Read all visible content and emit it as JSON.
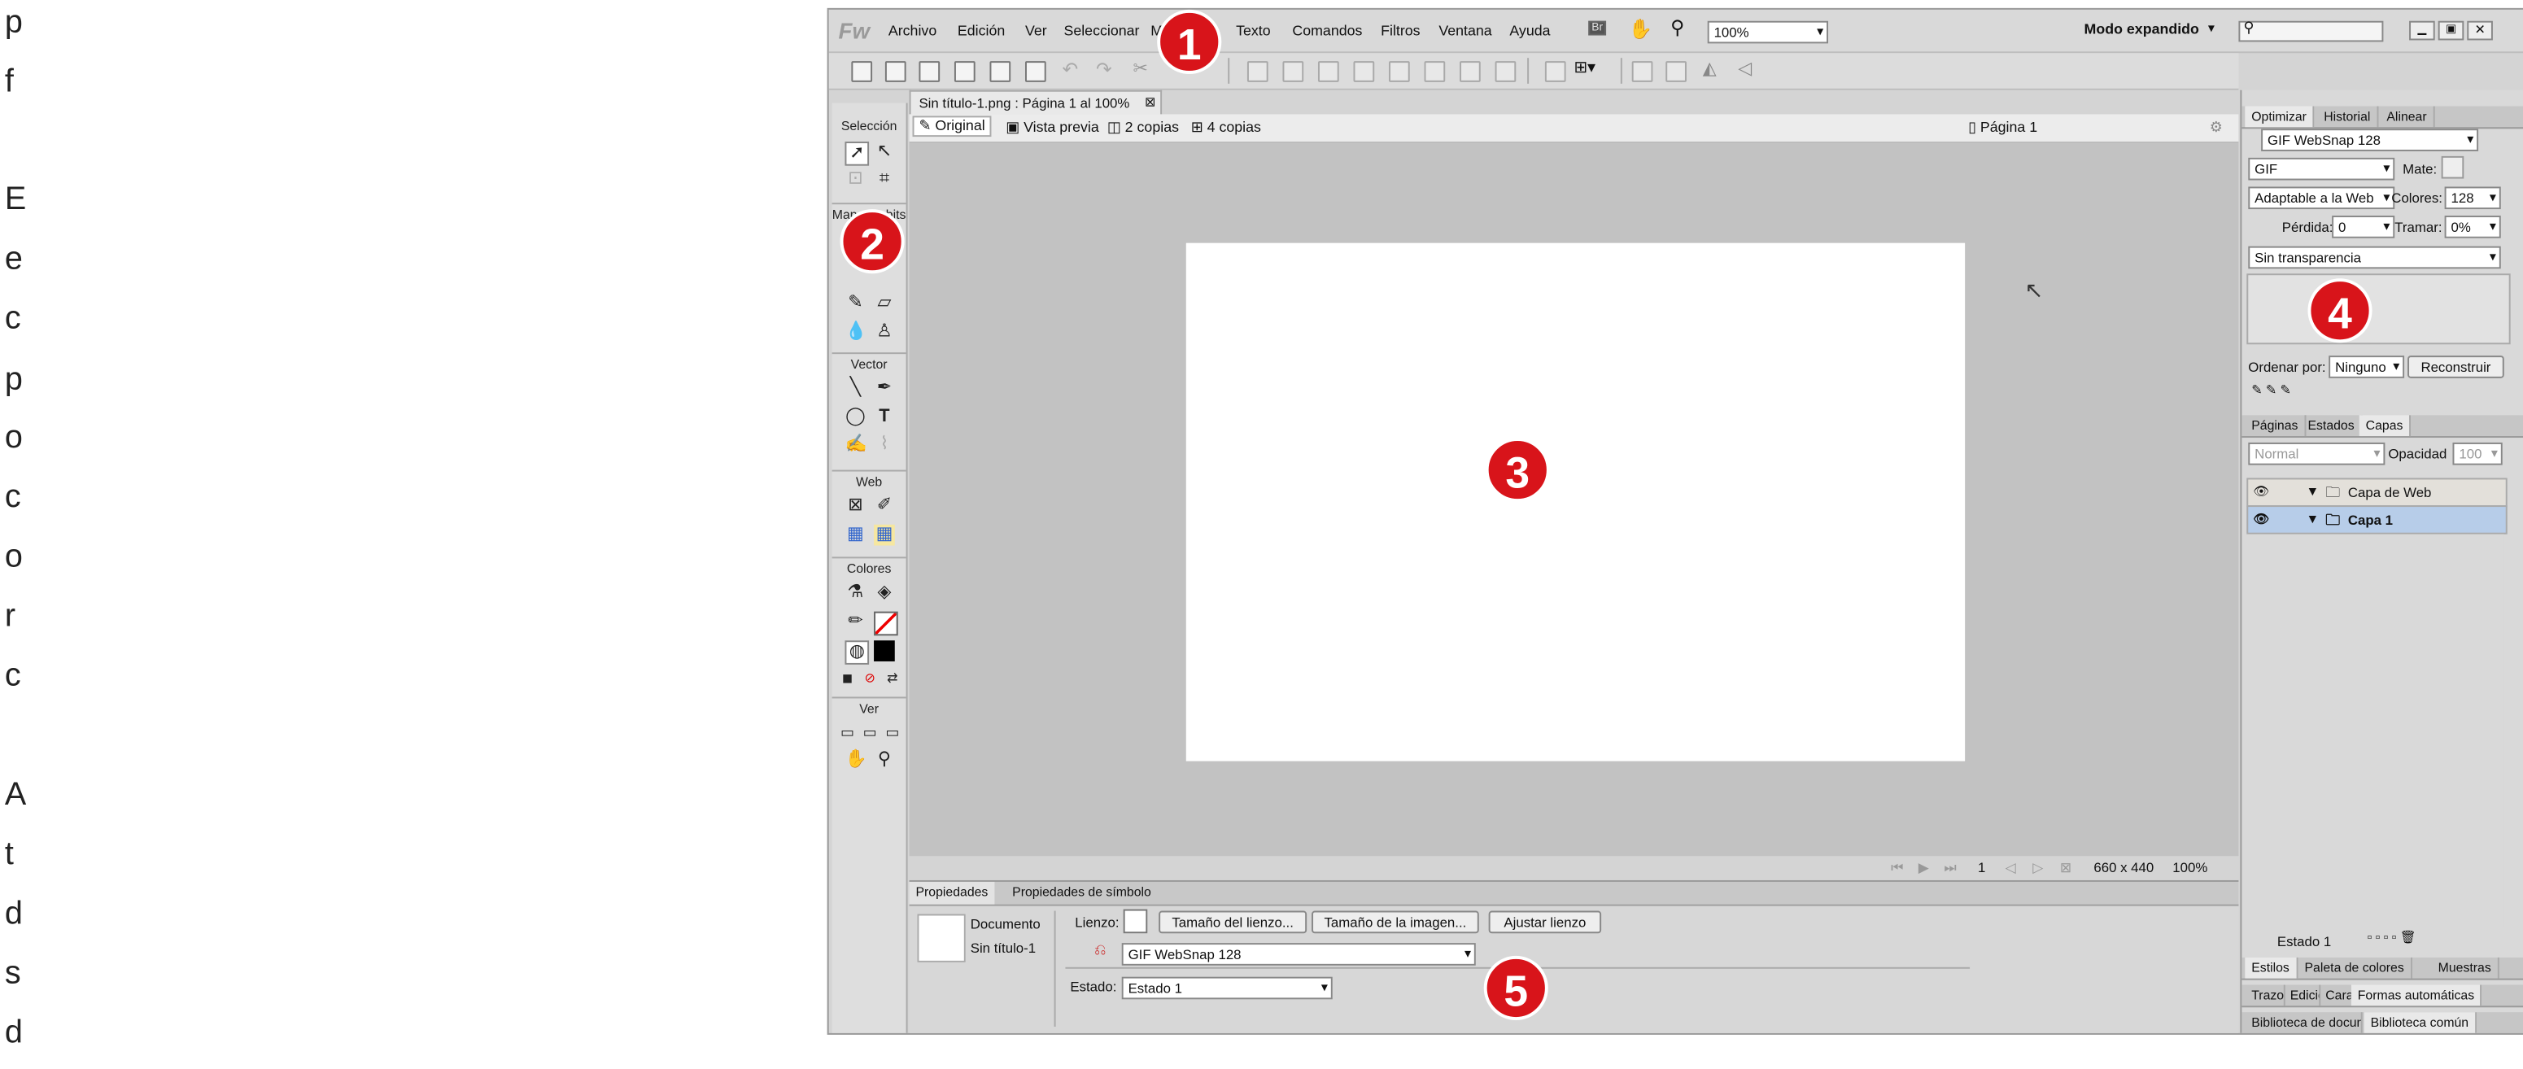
{
  "left_column_letters": [
    "p",
    "f",
    "E",
    "e",
    "c",
    "p",
    "o",
    "c",
    "o",
    "r",
    "c",
    "A",
    "t",
    "d",
    "s",
    "d"
  ],
  "app": {
    "logo": "Fw",
    "menu": [
      "Archivo",
      "Edición",
      "Ver",
      "Seleccionar",
      "Modificar",
      "Texto",
      "Comandos",
      "Filtros",
      "Ventana",
      "Ayuda"
    ],
    "menu_icons": [
      "Br",
      "hand-icon",
      "zoom-icon"
    ],
    "zoom_value": "100%",
    "workspace_mode": "Modo expandido",
    "search_placeholder": ""
  },
  "document": {
    "tab_title": "Sin título-1.png : Página 1 al 100%",
    "views": [
      "Original",
      "Vista previa",
      "2 copias",
      "4 copias"
    ],
    "page_label": "Página 1",
    "status_page": "1",
    "size": "660 x 440",
    "zoom": "100%"
  },
  "tools": {
    "sections": [
      "Selección",
      "Mapa de bits",
      "Vector",
      "Web",
      "Colores",
      "Ver"
    ]
  },
  "properties": {
    "tabs": [
      "Propiedades",
      "Propiedades de símbolo"
    ],
    "doc_type": "Documento",
    "doc_name": "Sin título-1",
    "canvas_label": "Lienzo:",
    "canvas_size_btn": "Tamaño del lienzo...",
    "image_size_btn": "Tamaño de la imagen...",
    "fit_canvas_btn": "Ajustar lienzo",
    "export_setting": "GIF WebSnap 128",
    "state_label": "Estado:",
    "state_value": "Estado 1"
  },
  "optimize": {
    "tabs": [
      "Optimizar",
      "Historial",
      "Alinear"
    ],
    "preset": "GIF WebSnap 128",
    "format": "GIF",
    "matte_label": "Mate:",
    "palette": "Adaptable a la Web",
    "colors_label": "Colores:",
    "colors_value": "128",
    "loss_label": "Pérdida:",
    "loss_value": "0",
    "dither_label": "Tramar:",
    "dither_value": "0%",
    "transparency": "Sin transparencia",
    "sort_label": "Ordenar por:",
    "sort_value": "Ninguno",
    "rebuild_btn": "Reconstruir"
  },
  "layers": {
    "tabs": [
      "Páginas",
      "Estados",
      "Capas"
    ],
    "blend": "Normal",
    "opacity_label": "Opacidad",
    "opacity_value": "100",
    "items": [
      "Capa de Web",
      "Capa 1"
    ],
    "state_footer": "Estado 1"
  },
  "bottom_panels": {
    "row1": [
      "Estilos",
      "Paleta de colores",
      "Muestras"
    ],
    "row2": [
      "Trazo",
      "Edición",
      "Caracteres",
      "Formas automáticas"
    ],
    "row3": [
      "Biblioteca de documentos",
      "Biblioteca común"
    ]
  },
  "callouts": [
    "1",
    "2",
    "3",
    "4",
    "5"
  ],
  "colors": {
    "callout": "#d8141a",
    "canvas_bg": "#c2c2c2",
    "layer_selected": "#b7cde9"
  }
}
